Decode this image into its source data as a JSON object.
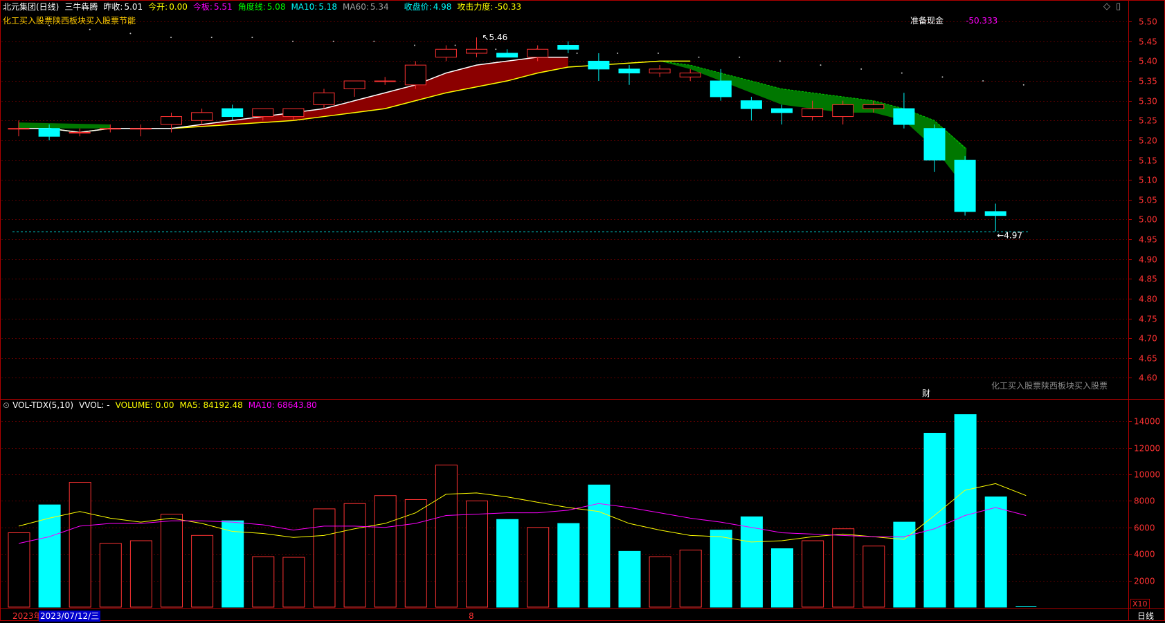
{
  "header": {
    "stock": "北元集团(日线)",
    "indicator": "三牛犇腾",
    "prev_close_label": "昨收:",
    "prev_close": "5.01",
    "open_label": "今开:",
    "open": "0.00",
    "limit_label": "今板:",
    "limit": "5.51",
    "angle_label": "角度线:",
    "angle": "5.08",
    "ma10_label": "MA10:",
    "ma10": "5.18",
    "ma60_label": "MA60:",
    "ma60": "5.34",
    "close_label": "收盘价:",
    "close": "4.98",
    "attack_label": "攻击力度:",
    "attack": "-50.33",
    "subtitle": "化工买入股票陕西板块买入股票节能",
    "cash_label": "准备现金",
    "cash": "-50.333",
    "watermark": "化工买入股票陕西板块买入股票",
    "fin_marker": "财"
  },
  "volume_header": {
    "name": "VOL-TDX(5,10)",
    "vvol": "VVOL: -",
    "volume": "VOLUME: 0.00",
    "ma5": "MA5: 84192.48",
    "ma10": "MA10: 68643.80"
  },
  "footer": {
    "year": "2023年",
    "date": "2023/07/12/三",
    "month_mark": "8",
    "period": "日线",
    "scale_badge": "X10"
  },
  "markers": {
    "high_label": "5.46",
    "low_label": "4.97"
  },
  "colors": {
    "up": "#ff3232",
    "down": "#00ffff",
    "ma_white": "#ffffff",
    "ma_yellow": "#ffff00",
    "band_red": "#8b0000",
    "band_green": "#007700",
    "axis": "#b00000",
    "vol_ma5": "#ffff00",
    "vol_ma10": "#ff00ff",
    "magenta": "#ff00ff",
    "green": "#00ff00"
  },
  "price_axis": {
    "ticks": [
      "5.50",
      "5.45",
      "5.40",
      "5.35",
      "5.30",
      "5.25",
      "5.20",
      "5.15",
      "5.10",
      "5.05",
      "5.00",
      "4.95",
      "4.90",
      "4.85",
      "4.80",
      "4.75",
      "4.70",
      "4.65",
      "4.60"
    ],
    "min": 4.55,
    "max": 5.53
  },
  "volume_axis": {
    "ticks": [
      "14000",
      "12000",
      "10000",
      "8000",
      "6000",
      "4000",
      "2000"
    ],
    "max": 15000
  },
  "candles": [
    {
      "o": 5.23,
      "h": 5.25,
      "l": 5.21,
      "c": 5.23
    },
    {
      "o": 5.23,
      "h": 5.24,
      "l": 5.2,
      "c": 5.21
    },
    {
      "o": 5.22,
      "h": 5.23,
      "l": 5.21,
      "c": 5.22
    },
    {
      "o": 5.23,
      "h": 5.24,
      "l": 5.22,
      "c": 5.23
    },
    {
      "o": 5.23,
      "h": 5.24,
      "l": 5.21,
      "c": 5.23
    },
    {
      "o": 5.24,
      "h": 5.27,
      "l": 5.22,
      "c": 5.26
    },
    {
      "o": 5.25,
      "h": 5.28,
      "l": 5.24,
      "c": 5.27
    },
    {
      "o": 5.28,
      "h": 5.29,
      "l": 5.25,
      "c": 5.26
    },
    {
      "o": 5.26,
      "h": 5.28,
      "l": 5.25,
      "c": 5.28
    },
    {
      "o": 5.26,
      "h": 5.28,
      "l": 5.25,
      "c": 5.28
    },
    {
      "o": 5.29,
      "h": 5.33,
      "l": 5.28,
      "c": 5.32
    },
    {
      "o": 5.33,
      "h": 5.35,
      "l": 5.31,
      "c": 5.35
    },
    {
      "o": 5.35,
      "h": 5.36,
      "l": 5.34,
      "c": 5.35
    },
    {
      "o": 5.34,
      "h": 5.4,
      "l": 5.33,
      "c": 5.39
    },
    {
      "o": 5.41,
      "h": 5.44,
      "l": 5.4,
      "c": 5.43
    },
    {
      "o": 5.42,
      "h": 5.46,
      "l": 5.41,
      "c": 5.43
    },
    {
      "o": 5.42,
      "h": 5.43,
      "l": 5.41,
      "c": 5.41
    },
    {
      "o": 5.41,
      "h": 5.44,
      "l": 5.4,
      "c": 5.43
    },
    {
      "o": 5.44,
      "h": 5.45,
      "l": 5.42,
      "c": 5.43
    },
    {
      "o": 5.4,
      "h": 5.42,
      "l": 5.35,
      "c": 5.38
    },
    {
      "o": 5.38,
      "h": 5.39,
      "l": 5.34,
      "c": 5.37
    },
    {
      "o": 5.37,
      "h": 5.39,
      "l": 5.36,
      "c": 5.38
    },
    {
      "o": 5.36,
      "h": 5.38,
      "l": 5.35,
      "c": 5.37
    },
    {
      "o": 5.35,
      "h": 5.38,
      "l": 5.3,
      "c": 5.31
    },
    {
      "o": 5.3,
      "h": 5.31,
      "l": 5.25,
      "c": 5.28
    },
    {
      "o": 5.28,
      "h": 5.29,
      "l": 5.24,
      "c": 5.27
    },
    {
      "o": 5.26,
      "h": 5.3,
      "l": 5.25,
      "c": 5.28
    },
    {
      "o": 5.26,
      "h": 5.3,
      "l": 5.24,
      "c": 5.29
    },
    {
      "o": 5.28,
      "h": 5.3,
      "l": 5.27,
      "c": 5.29
    },
    {
      "o": 5.28,
      "h": 5.32,
      "l": 5.23,
      "c": 5.24
    },
    {
      "o": 5.23,
      "h": 5.24,
      "l": 5.12,
      "c": 5.15
    },
    {
      "o": 5.15,
      "h": 5.16,
      "l": 5.01,
      "c": 5.02
    },
    {
      "o": 5.02,
      "h": 5.04,
      "l": 4.97,
      "c": 5.01
    }
  ],
  "ma_white": [
    5.23,
    5.23,
    5.22,
    5.23,
    5.23,
    5.23,
    5.24,
    5.25,
    5.26,
    5.27,
    5.28,
    5.3,
    5.32,
    5.34,
    5.37,
    5.39,
    5.4,
    5.41,
    5.41
  ],
  "ma_yellow": [
    5.23,
    5.23,
    5.22,
    5.23,
    5.23,
    5.23,
    5.235,
    5.24,
    5.245,
    5.25,
    5.26,
    5.27,
    5.28,
    5.3,
    5.32,
    5.335,
    5.35,
    5.37,
    5.385,
    5.39,
    5.395,
    5.4,
    5.4
  ],
  "green_band_top": [
    5.4,
    5.39,
    5.37,
    5.35,
    5.33,
    5.32,
    5.31,
    5.3,
    5.28,
    5.25,
    5.18
  ],
  "green_band_bottom": [
    5.4,
    5.38,
    5.35,
    5.32,
    5.29,
    5.28,
    5.27,
    5.27,
    5.25,
    5.18,
    5.08
  ],
  "ma60_dots": [
    5.49,
    5.48,
    5.47,
    5.46,
    5.46,
    5.46,
    5.45,
    5.45,
    5.45,
    5.44,
    5.44,
    5.43,
    5.43,
    5.42,
    5.42,
    5.42,
    5.41,
    5.41,
    5.4,
    5.39,
    5.38,
    5.37,
    5.36,
    5.35,
    5.34
  ],
  "volumes": [
    5600,
    7700,
    9400,
    4800,
    5000,
    7000,
    5400,
    6500,
    3800,
    3750,
    7400,
    7800,
    8400,
    8100,
    10700,
    8000,
    6600,
    6000,
    6300,
    9200,
    4200,
    3800,
    4300,
    5800,
    6800,
    4400,
    5000,
    5900,
    4600,
    6400,
    13100,
    14500,
    8300,
    0
  ],
  "vol_ma5": [
    6100,
    6700,
    7200,
    6700,
    6400,
    6700,
    6300,
    5700,
    5550,
    5250,
    5400,
    5900,
    6300,
    7100,
    8500,
    8600,
    8300,
    7900,
    7500,
    7200,
    6300,
    5800,
    5400,
    5300,
    4900,
    5000,
    5300,
    5500,
    5300,
    5100,
    6900,
    8800,
    9300,
    8400
  ],
  "vol_ma10": [
    4800,
    5300,
    6100,
    6300,
    6300,
    6500,
    6500,
    6400,
    6200,
    5800,
    6100,
    6100,
    6000,
    6300,
    6900,
    7000,
    7100,
    7100,
    7300,
    7800,
    7500,
    7100,
    6700,
    6400,
    6000,
    5600,
    5500,
    5400,
    5300,
    5300,
    5900,
    6900,
    7500,
    6900
  ]
}
